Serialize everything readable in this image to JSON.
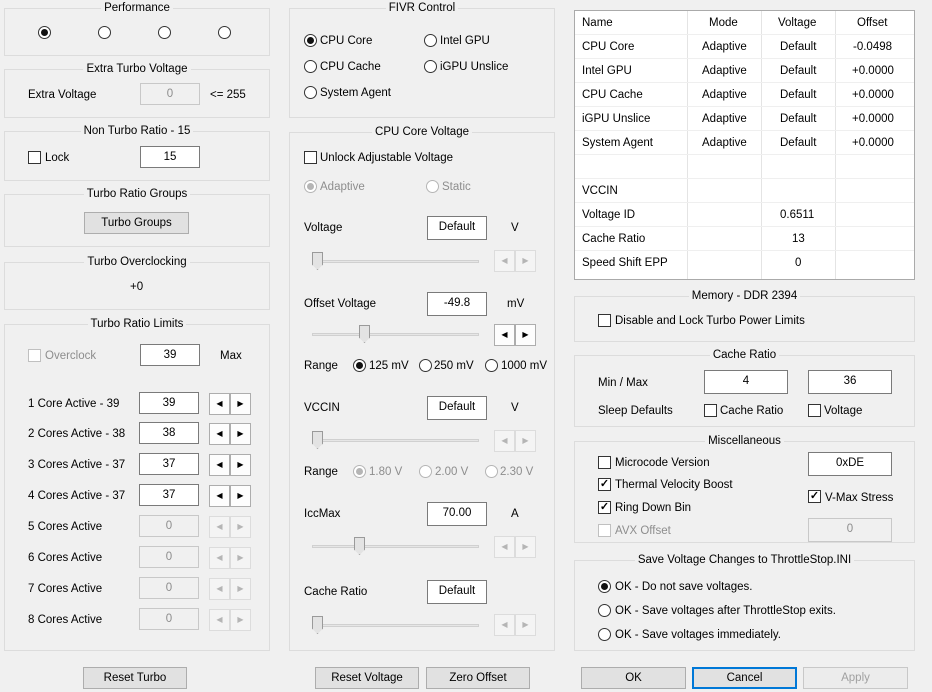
{
  "performance": {
    "title": "Performance"
  },
  "extra_turbo": {
    "title": "Extra Turbo Voltage",
    "label": "Extra Voltage",
    "value": "0",
    "limit": "<= 255"
  },
  "non_turbo": {
    "title": "Non Turbo Ratio - 15",
    "lock_label": "Lock",
    "value": "15"
  },
  "turbo_groups": {
    "title": "Turbo Ratio Groups",
    "button": "Turbo Groups"
  },
  "turbo_oc": {
    "title": "Turbo Overclocking",
    "value": "+0"
  },
  "turbo_limits": {
    "title": "Turbo Ratio Limits",
    "overclock_label": "Overclock",
    "max_value": "39",
    "max_label": "Max",
    "rows": [
      {
        "label": "1 Core  Active - 39",
        "value": "39"
      },
      {
        "label": "2 Cores Active - 38",
        "value": "38"
      },
      {
        "label": "3 Cores Active - 37",
        "value": "37"
      },
      {
        "label": "4 Cores Active - 37",
        "value": "37"
      },
      {
        "label": "5 Cores Active",
        "value": "0"
      },
      {
        "label": "6 Cores Active",
        "value": "0"
      },
      {
        "label": "7 Cores Active",
        "value": "0"
      },
      {
        "label": "8 Cores Active",
        "value": "0"
      }
    ]
  },
  "fivr": {
    "title": "FIVR Control",
    "options": [
      "CPU Core",
      "Intel GPU",
      "CPU Cache",
      "iGPU Unslice",
      "System Agent"
    ]
  },
  "core_voltage": {
    "title": "CPU Core Voltage",
    "unlock_label": "Unlock Adjustable Voltage",
    "adaptive_label": "Adaptive",
    "static_label": "Static",
    "voltage_label": "Voltage",
    "voltage_value": "Default",
    "voltage_unit": "V",
    "offset_label": "Offset Voltage",
    "offset_value": "-49.8",
    "offset_unit": "mV",
    "range_label": "Range",
    "range_options": [
      "125 mV",
      "250 mV",
      "1000 mV"
    ],
    "vccin_label": "VCCIN",
    "vccin_value": "Default",
    "vccin_unit": "V",
    "range2_label": "Range",
    "range2_options": [
      "1.80 V",
      "2.00 V",
      "2.30 V"
    ],
    "iccmax_label": "IccMax",
    "iccmax_value": "70.00",
    "iccmax_unit": "A",
    "cache_ratio_label": "Cache Ratio",
    "cache_ratio_value": "Default"
  },
  "table": {
    "headers": [
      "Name",
      "Mode",
      "Voltage",
      "Offset"
    ],
    "rows": [
      [
        "CPU Core",
        "Adaptive",
        "Default",
        "-0.0498"
      ],
      [
        "Intel GPU",
        "Adaptive",
        "Default",
        "+0.0000"
      ],
      [
        "CPU Cache",
        "Adaptive",
        "Default",
        "+0.0000"
      ],
      [
        "iGPU Unslice",
        "Adaptive",
        "Default",
        "+0.0000"
      ],
      [
        "System Agent",
        "Adaptive",
        "Default",
        "+0.0000"
      ],
      [
        "",
        "",
        "",
        ""
      ],
      [
        "VCCIN",
        "",
        "",
        ""
      ],
      [
        "Voltage ID",
        "",
        "0.6511",
        ""
      ],
      [
        "Cache Ratio",
        "",
        "13",
        ""
      ],
      [
        "Speed Shift EPP",
        "",
        "0",
        ""
      ]
    ]
  },
  "memory": {
    "title": "Memory - DDR 2394",
    "disable_label": "Disable and Lock Turbo Power Limits"
  },
  "cache_ratio": {
    "title": "Cache Ratio",
    "minmax_label": "Min / Max",
    "min": "4",
    "max": "36",
    "sleep_label": "Sleep Defaults",
    "cache_ratio_check": "Cache Ratio",
    "voltage_check": "Voltage"
  },
  "misc": {
    "title": "Miscellaneous",
    "microcode_label": "Microcode Version",
    "microcode_value": "0xDE",
    "tvb_label": "Thermal Velocity Boost",
    "ringdown_label": "Ring Down Bin",
    "vmax_label": "V-Max Stress",
    "avx_label": "AVX Offset",
    "avx_value": "0"
  },
  "save": {
    "title": "Save Voltage Changes to ThrottleStop.INI",
    "options": [
      "OK - Do not save voltages.",
      "OK - Save voltages after ThrottleStop exits.",
      "OK - Save voltages immediately."
    ]
  },
  "buttons": {
    "reset_turbo": "Reset Turbo",
    "reset_voltage": "Reset Voltage",
    "zero_offset": "Zero Offset",
    "ok": "OK",
    "cancel": "Cancel",
    "apply": "Apply"
  }
}
